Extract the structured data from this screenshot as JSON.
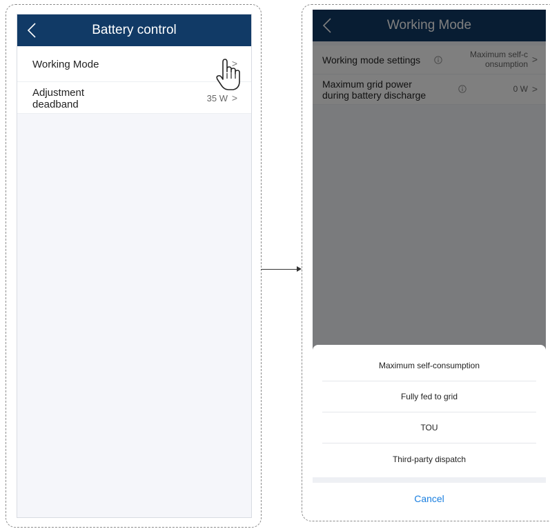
{
  "left_screen": {
    "title": "Battery control",
    "rows": [
      {
        "label": "Working Mode",
        "value": ""
      },
      {
        "label_line1": "Adjustment",
        "label_line2": "deadband",
        "value": "35 W"
      }
    ]
  },
  "right_screen": {
    "title": "Working Mode",
    "rows": [
      {
        "label": "Working mode settings",
        "value_line1": "Maximum self-c",
        "value_line2": "onsumption"
      },
      {
        "label_line1": "Maximum grid power",
        "label_line2": "during battery discharge",
        "value": "0 W"
      }
    ],
    "sheet": {
      "options": [
        "Maximum self-consumption",
        "Fully fed to grid",
        "TOU",
        "Third-party dispatch"
      ],
      "cancel": "Cancel"
    }
  },
  "icons": {
    "back": "chevron-left-icon",
    "row_arrow": "chevron-right-icon",
    "info": "info-icon",
    "cursor": "pointing-hand-icon"
  },
  "colors": {
    "titlebar": "#113a66",
    "accent": "#1a7fe0",
    "page_bg": "#f5f6fa"
  }
}
